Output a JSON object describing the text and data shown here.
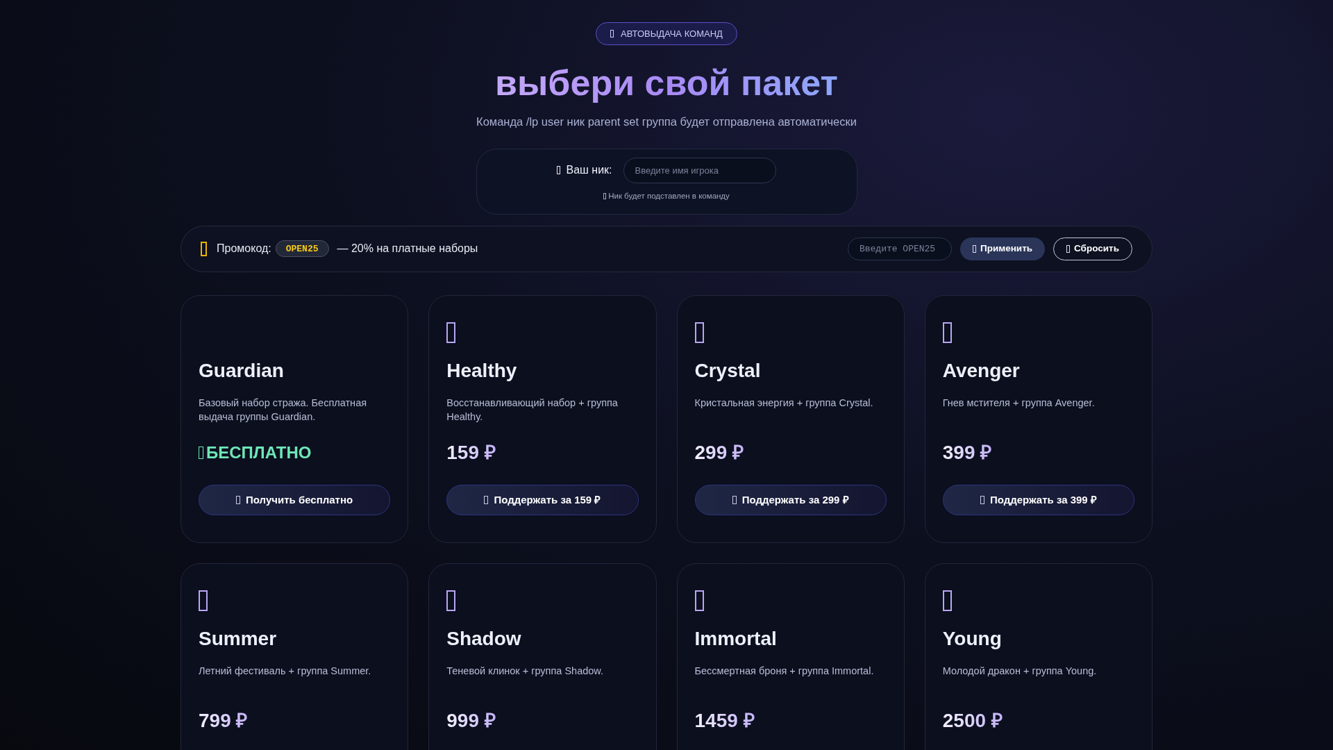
{
  "badge": {
    "icon_glyph": true,
    "label": "АВТОВЫДАЧА КОМАНД"
  },
  "title": "выбери свой пакет",
  "subtitle": "Команда /lp user ник parent set группа будет отправлена автоматически",
  "nick": {
    "label": "Ваш ник:",
    "placeholder": "Введите имя игрока",
    "hint": "Ник будет подставлен в команду"
  },
  "promo": {
    "label": "Промокод:",
    "code": "OPEN25",
    "description": "— 20% на платные наборы",
    "placeholder": "Введите OPEN25",
    "apply": "Применить",
    "reset": "Сбросить"
  },
  "cards": [
    {
      "kind": "free",
      "icon_glyph": false,
      "name": "Guardian",
      "description": "Базовый набор стража. Бесплатная выдача группы Guardian.",
      "price": "БЕСПЛАТНО",
      "button": "Получить бесплатно"
    },
    {
      "kind": "paid",
      "icon_glyph": true,
      "name": "Healthy",
      "description": "Восстанавливающий набор + группа Healthy.",
      "price": "159 ₽",
      "button": "Поддержать за 159 ₽"
    },
    {
      "kind": "paid",
      "icon_glyph": true,
      "name": "Crystal",
      "description": "Кристальная энергия + группа Crystal.",
      "price": "299 ₽",
      "button": "Поддержать за 299 ₽"
    },
    {
      "kind": "paid",
      "icon_glyph": true,
      "name": "Avenger",
      "description": "Гнев мстителя + группа Avenger.",
      "price": "399 ₽",
      "button": "Поддержать за 399 ₽"
    },
    {
      "kind": "paid",
      "icon_glyph": true,
      "name": "Summer",
      "description": "Летний фестиваль + группа Summer.",
      "price": "799 ₽"
    },
    {
      "kind": "paid",
      "icon_glyph": true,
      "name": "Shadow",
      "description": "Теневой клинок + группа Shadow.",
      "price": "999 ₽"
    },
    {
      "kind": "paid",
      "icon_glyph": true,
      "name": "Immortal",
      "description": "Бессмертная броня + группа Immortal.",
      "price": "1459 ₽"
    },
    {
      "kind": "paid",
      "icon_glyph": true,
      "name": "Young",
      "description": "Молодой дракон + группа Young.",
      "price": "2500 ₽"
    }
  ]
}
